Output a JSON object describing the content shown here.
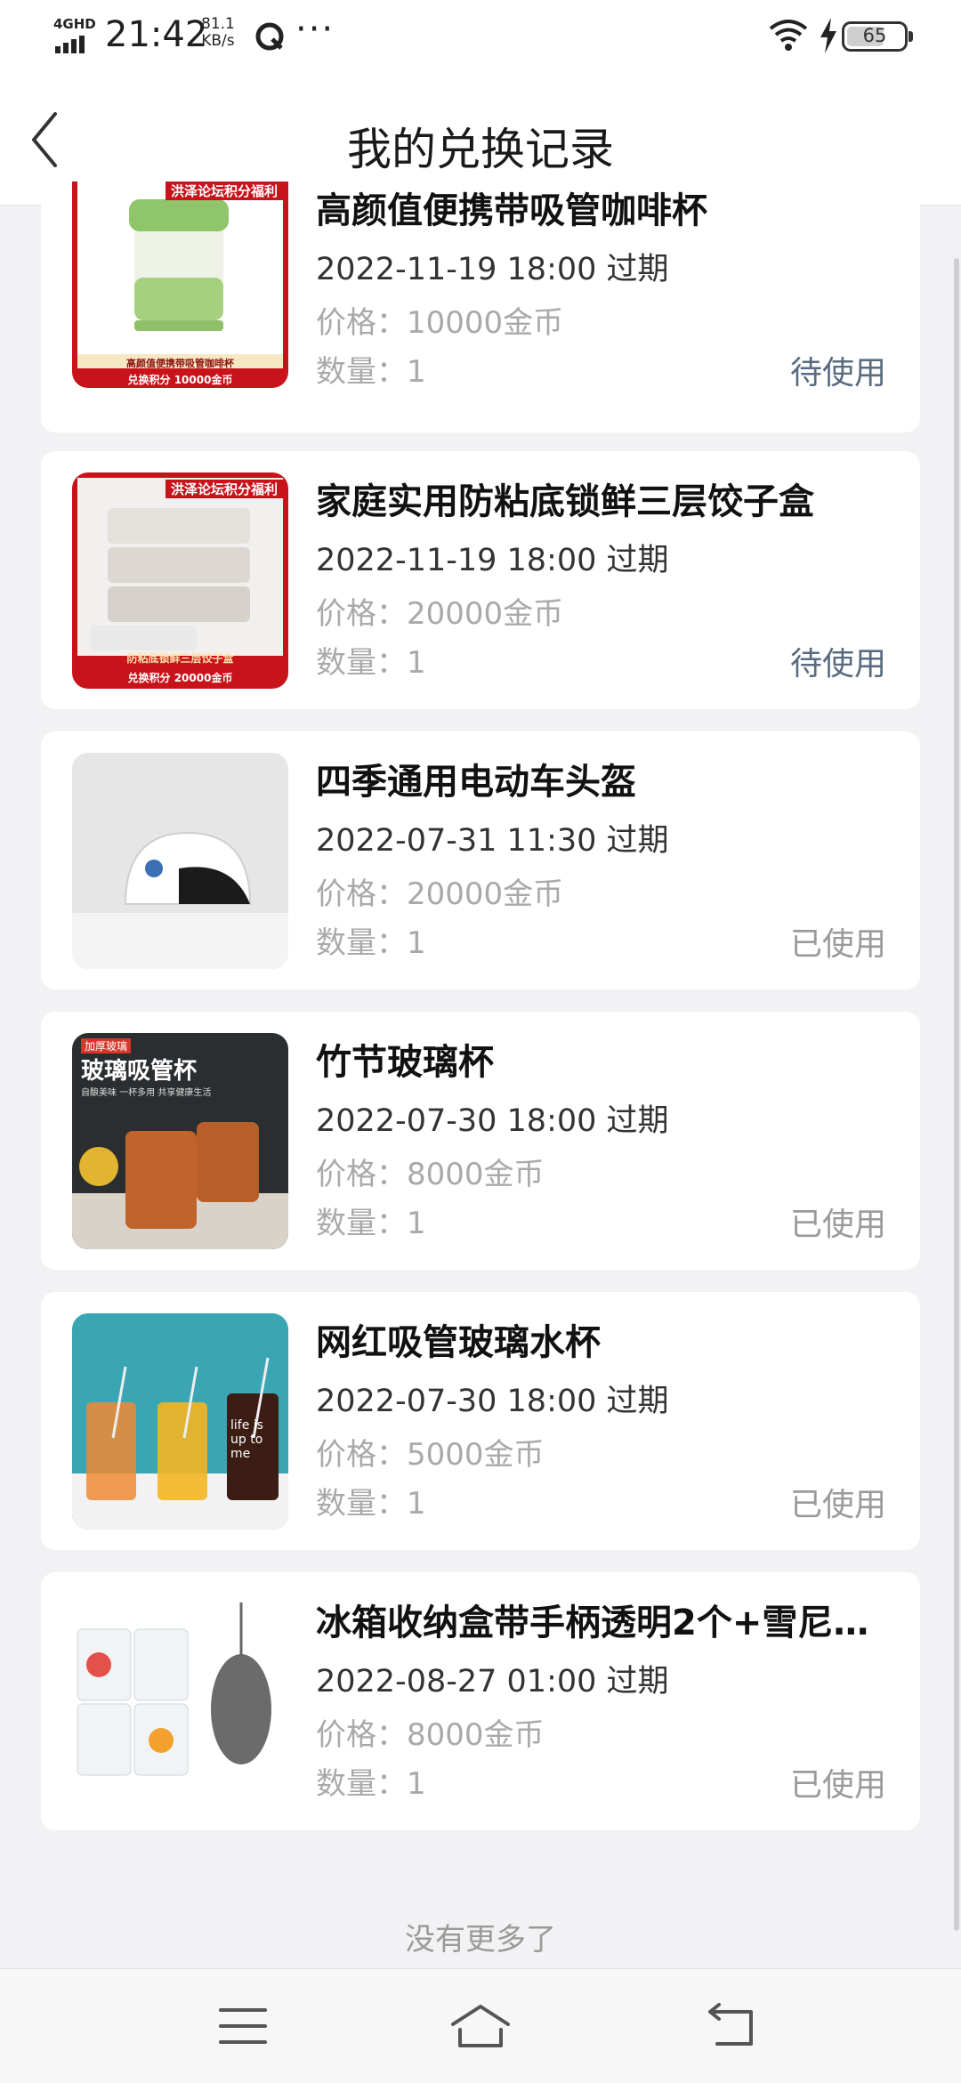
{
  "status_bar": {
    "network": "4GHD",
    "time": "21:42",
    "speed_value": "81.1",
    "speed_unit": "KB/s",
    "more": "···",
    "battery": "65"
  },
  "header": {
    "title": "我的兑换记录"
  },
  "labels": {
    "price_prefix": "价格：",
    "qty_prefix": "数量："
  },
  "records": [
    {
      "title": "高颜值便携带吸管咖啡杯",
      "expire": "2022-11-19 18:00 过期",
      "price": "价格：10000金币",
      "qty": "数量：1",
      "status": "待使用",
      "thumb_banner": "洪泽论坛积分福利",
      "thumb_caption": "高颜值便携带吸管咖啡杯",
      "thumb_points": "兑换积分   10000金币"
    },
    {
      "title": "家庭实用防粘底锁鲜三层饺子盒",
      "expire": "2022-11-19 18:00 过期",
      "price": "价格：20000金币",
      "qty": "数量：1",
      "status": "待使用",
      "thumb_banner": "洪泽论坛积分福利",
      "thumb_caption": "防粘底锁鲜三层饺子盒",
      "thumb_points": "兑换积分   20000金币"
    },
    {
      "title": "四季通用电动车头盔",
      "expire": "2022-07-31 11:30 过期",
      "price": "价格：20000金币",
      "qty": "数量：1",
      "status": "已使用"
    },
    {
      "title": "竹节玻璃杯",
      "expire": "2022-07-30 18:00 过期",
      "price": "价格：8000金币",
      "qty": "数量：1",
      "status": "已使用",
      "thumb_badge": "加厚玻璃",
      "thumb_caption": "玻璃吸管杯",
      "thumb_sub": "自酿美味 一杯多用 共享健康生活"
    },
    {
      "title": "网红吸管玻璃水杯",
      "expire": "2022-07-30 18:00 过期",
      "price": "价格：5000金币",
      "qty": "数量：1",
      "status": "已使用",
      "thumb_cup_text": "life is up to me"
    },
    {
      "title": "冰箱收纳盒带手柄透明2个+雪尼…",
      "expire": "2022-08-27 01:00 过期",
      "price": "价格：8000金币",
      "qty": "数量：1",
      "status": "已使用"
    }
  ],
  "footer": {
    "no_more": "没有更多了"
  },
  "colors": {
    "pending": "#5a6b80",
    "used": "#9a9a9a",
    "banner_red": "#c8131b",
    "background": "#f2f2f4"
  },
  "nav": {
    "menu_icon": "menu-icon",
    "home_icon": "home-icon",
    "back_icon": "return-icon"
  }
}
